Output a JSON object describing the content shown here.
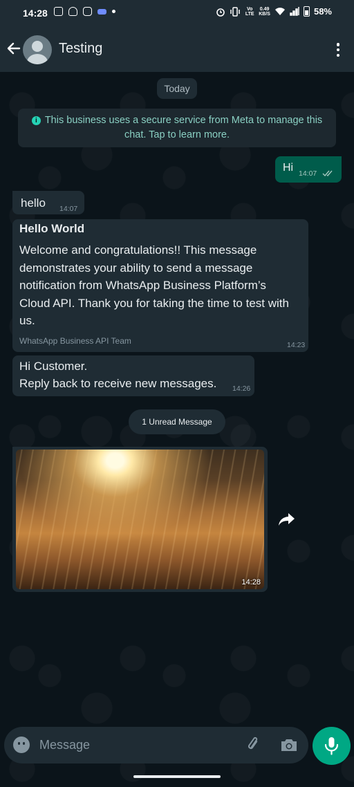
{
  "status_bar": {
    "time": "14:28",
    "net_speed_value": "0.49",
    "net_speed_unit": "KB/S",
    "volte": "Vo LTE",
    "battery": "58%"
  },
  "header": {
    "contact_name": "Testing"
  },
  "chat": {
    "date_chip": "Today",
    "business_notice": "This business uses a secure service from Meta to manage this chat. Tap to learn more.",
    "messages": [
      {
        "direction": "out",
        "text": "Hi",
        "time": "14:07",
        "status": "read"
      },
      {
        "direction": "in",
        "text": "hello",
        "time": "14:07"
      },
      {
        "direction": "in",
        "header": "Hello World",
        "text": "Welcome and congratulations!! This message demonstrates your ability to send a message notification from WhatsApp Business Platform’s Cloud API. Thank you for taking the time to test with us.",
        "footer": "WhatsApp Business API Team",
        "time": "14:23"
      },
      {
        "direction": "in",
        "line1": "Hi Customer.",
        "line2": "Reply back to receive new messages.",
        "time": "14:26"
      },
      {
        "direction": "in",
        "type": "image",
        "time": "14:28"
      }
    ],
    "unread_chip": "1 Unread Message"
  },
  "composer": {
    "placeholder": "Message"
  },
  "colors": {
    "background": "#0b141a",
    "bar": "#1f2c34",
    "outgoing_bubble": "#005c4b",
    "incoming_bubble": "#1f2c34",
    "accent": "#00a884"
  },
  "icons": [
    "back-arrow-icon",
    "avatar-icon",
    "more-vert-icon",
    "info-icon",
    "double-check-icon",
    "forward-icon",
    "emoji-icon",
    "attach-icon",
    "camera-icon",
    "mic-icon"
  ]
}
